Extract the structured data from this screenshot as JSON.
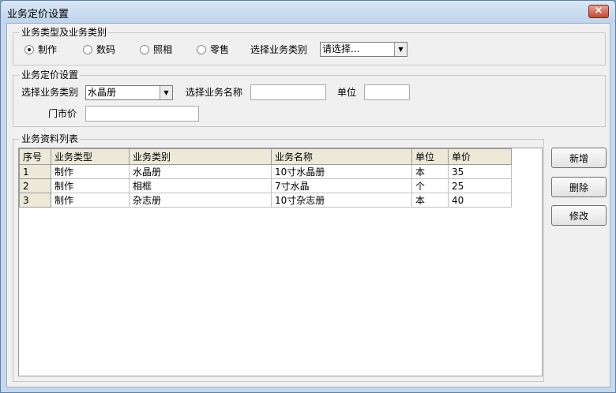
{
  "window": {
    "title": "业务定价设置",
    "close_label": "×"
  },
  "type_group": {
    "legend": "业务类型及业务类别",
    "radios": [
      {
        "label": "制作",
        "checked": true
      },
      {
        "label": "数码",
        "checked": false
      },
      {
        "label": "照相",
        "checked": false
      },
      {
        "label": "零售",
        "checked": false
      }
    ],
    "category_label": "选择业务类别",
    "category_value": "请选择..."
  },
  "pricing_group": {
    "legend": "业务定价设置",
    "category_label": "选择业务类别",
    "category_value": "水晶册",
    "name_label": "选择业务名称",
    "name_value": "",
    "unit_label": "单位",
    "unit_value": "",
    "price_label": "门市价",
    "price_value": ""
  },
  "list_group": {
    "legend": "业务资料列表",
    "columns": [
      "序号",
      "业务类型",
      "业务类别",
      "业务名称",
      "单位",
      "单价"
    ],
    "rows": [
      [
        "1",
        "制作",
        "水晶册",
        "10寸水晶册",
        "本",
        "35"
      ],
      [
        "2",
        "制作",
        "相框",
        "7寸水晶",
        "个",
        "25"
      ],
      [
        "3",
        "制作",
        "杂志册",
        "10寸杂志册",
        "本",
        "40"
      ]
    ]
  },
  "actions": {
    "add": "新增",
    "delete": "删除",
    "modify": "修改"
  },
  "colors": {
    "window_frame": "#c6d8ec",
    "client_bg": "#f0f0f0",
    "close_button": "#c24a30"
  }
}
